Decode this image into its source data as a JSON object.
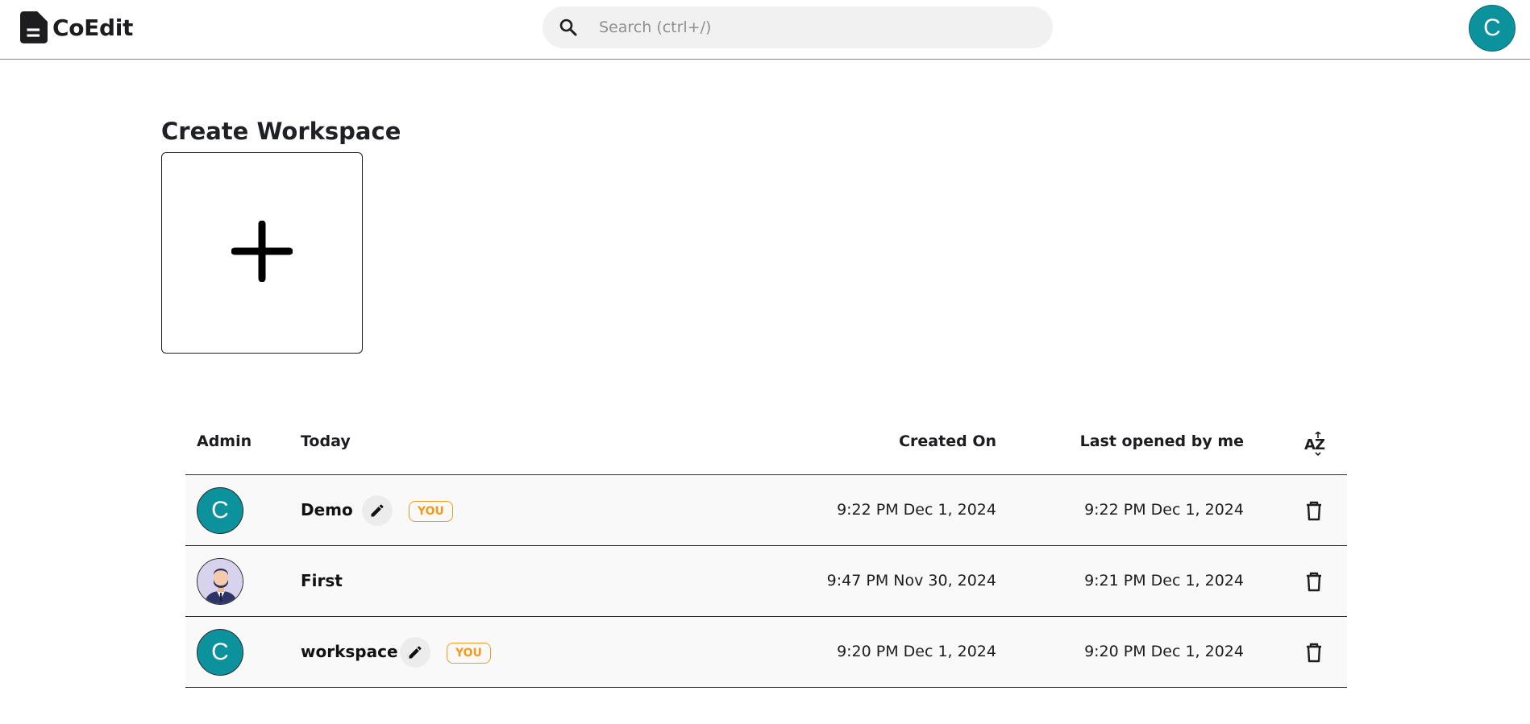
{
  "app": {
    "name": "CoEdit",
    "avatar_letter": "C",
    "accent": "#0b929c"
  },
  "search": {
    "placeholder": "Search (ctrl+/)",
    "value": ""
  },
  "create": {
    "title": "Create Workspace"
  },
  "table": {
    "headers": {
      "admin": "Admin",
      "today": "Today",
      "created": "Created On",
      "last_opened": "Last opened by me",
      "sort": "AZ"
    },
    "rows": [
      {
        "avatar": "C",
        "avatar_type": "letter",
        "name": "Demo",
        "editable": true,
        "badge": "YOU",
        "created": "9:22 PM Dec 1, 2024",
        "last_opened": "9:22 PM Dec 1, 2024"
      },
      {
        "avatar": "",
        "avatar_type": "person-illustration",
        "name": "First",
        "editable": false,
        "badge": "",
        "created": "9:47 PM Nov 30, 2024",
        "last_opened": "9:21 PM Dec 1, 2024"
      },
      {
        "avatar": "C",
        "avatar_type": "letter",
        "name": "workspace",
        "editable": true,
        "badge": "YOU",
        "created": "9:20 PM Dec 1, 2024",
        "last_opened": "9:20 PM Dec 1, 2024"
      }
    ]
  },
  "colors": {
    "badge": "#f29a1d",
    "row_bg": "#f9f9f9"
  }
}
